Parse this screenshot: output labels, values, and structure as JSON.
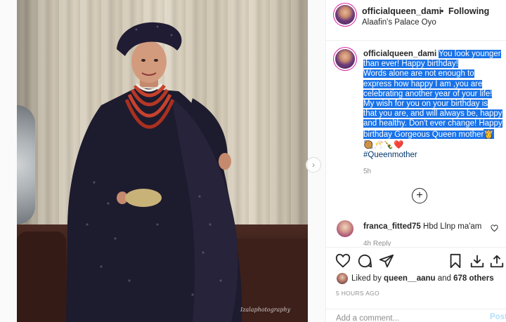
{
  "post": {
    "photo_watermark": "Izalaphotography",
    "header": {
      "username": "officialqueen_dami",
      "separator": "•",
      "follow_status": "Following",
      "location": "Alaafin's Palace Oyo"
    },
    "caption": {
      "username": "officialqueen_dami",
      "text_line1": "You look younger than ever! Happy birthday!",
      "text_line2": "Words alone are not enough to express how happy I am ,you are celebrating another year of your life!",
      "text_line3": "My wish for you on your birthday is that you are, and will always be, happy and healthy. Don't ever change! Happy birthday Gorgeous Queen mother",
      "emoji_queen": "👸",
      "emoji_row": "🥘🥂🍾❤️",
      "hashtag": "#Queenmother",
      "age": "5h"
    },
    "load_more_icon": "plus-circle-icon",
    "comment": {
      "username": "franca_fitted75",
      "text": "Hbd Llnp ma'am",
      "meta": "4h   Reply",
      "like_icon": "heart-outline-icon"
    },
    "actions": {
      "icons": [
        "heart-outline-icon",
        "comment-bubble-icon",
        "share-plane-icon",
        "bookmark-icon",
        "download-icon",
        "upload-icon"
      ]
    },
    "likes": {
      "prefix": "Liked by",
      "user": "queen__aanu",
      "middle": "and",
      "others": "678 others"
    },
    "timestamp": "5 HOURS AGO",
    "add_comment": {
      "placeholder": "Add a comment...",
      "post_label": "Post"
    },
    "colors": {
      "highlight": "#1a73e8",
      "hashtag": "#00376b",
      "post_disabled": "#b2dffc",
      "muted": "#8e8e8e"
    }
  }
}
